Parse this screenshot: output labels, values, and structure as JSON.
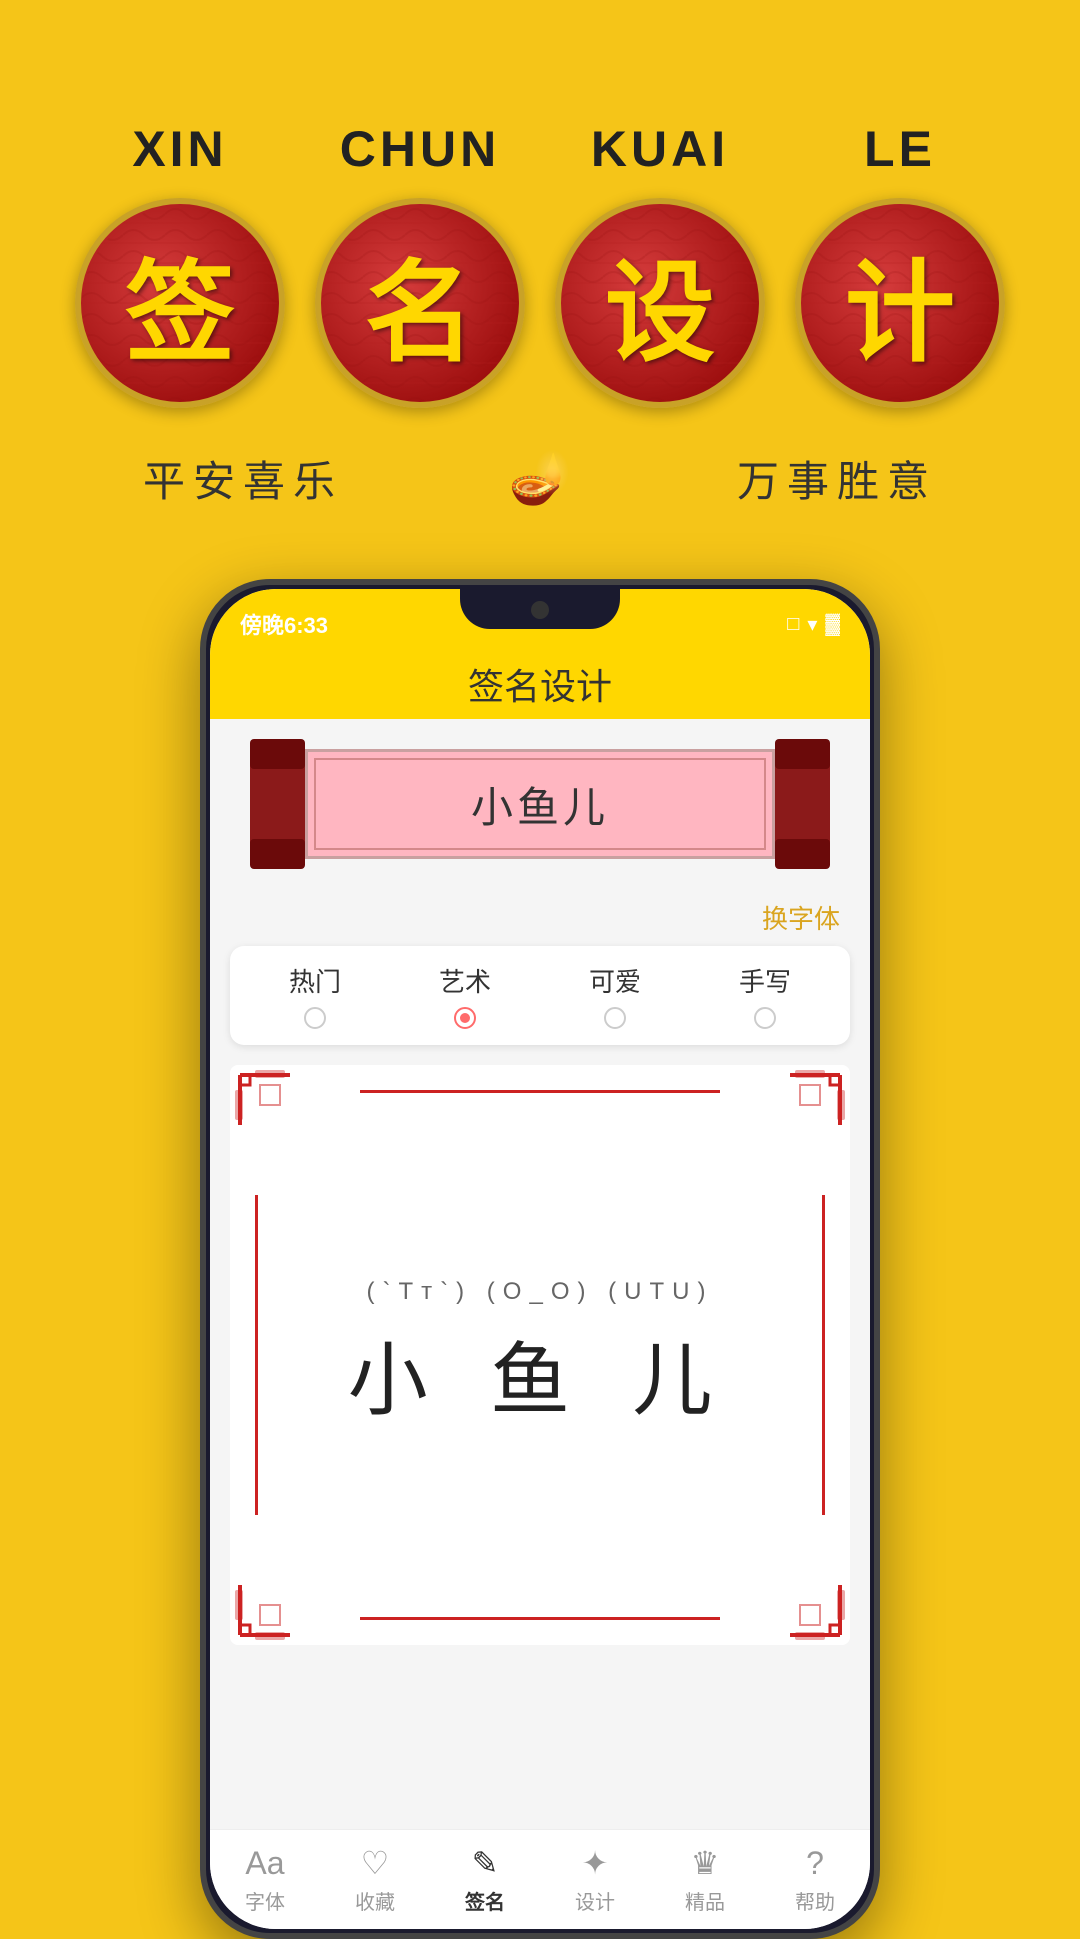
{
  "background_color": "#F5C518",
  "top_section": {
    "pinyin": [
      "XIN",
      "CHUN",
      "KUAI",
      "LE"
    ],
    "characters": [
      "签",
      "名",
      "设",
      "计"
    ],
    "subtitle_left": "平安喜乐",
    "subtitle_right": "万事胜意",
    "subtitle_icon": "🪔"
  },
  "phone": {
    "status_bar": {
      "time": "傍晚6:33",
      "icons": "□ ▾ ▓"
    },
    "app_title": "签名设计",
    "scroll_name": "小鱼儿",
    "change_font": "换字体",
    "font_tabs": [
      {
        "label": "热门",
        "active": false
      },
      {
        "label": "艺术",
        "active": true
      },
      {
        "label": "可爱",
        "active": false
      },
      {
        "label": "手写",
        "active": false
      }
    ],
    "signature": {
      "emoji_row": "(`Tᴛ`)  (O_O)  (UTU)",
      "chars": "小  鱼  儿"
    },
    "bottom_nav": [
      {
        "icon": "Aa",
        "label": "字体",
        "active": false
      },
      {
        "icon": "♡",
        "label": "收藏",
        "active": false
      },
      {
        "icon": "✎",
        "label": "签名",
        "active": true
      },
      {
        "icon": "✦",
        "label": "设计",
        "active": false
      },
      {
        "icon": "♛",
        "label": "精品",
        "active": false
      },
      {
        "icon": "?",
        "label": "帮助",
        "active": false
      }
    ]
  }
}
